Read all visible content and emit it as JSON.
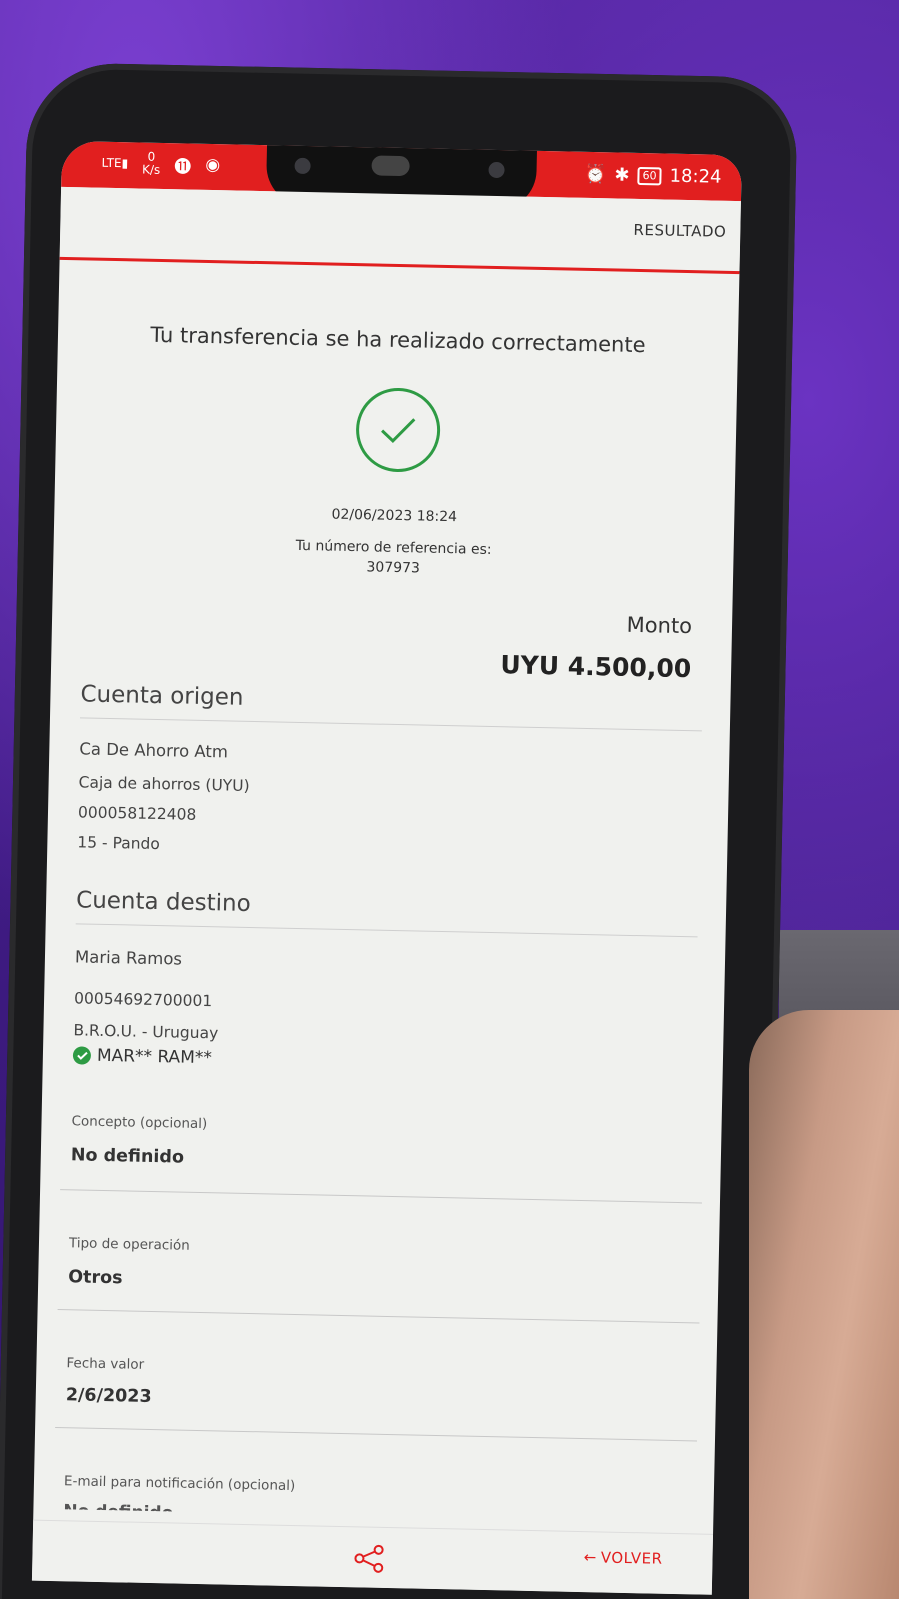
{
  "status_bar": {
    "network": "LTE",
    "speed_value": "0",
    "speed_unit": "K/s",
    "battery": "60",
    "time": "18:24"
  },
  "header": {
    "title": "RESULTADO"
  },
  "result": {
    "message": "Tu transferencia se ha realizado correctamente",
    "datetime": "02/06/2023 18:24",
    "reference_label": "Tu número de referencia es:",
    "reference_number": "307973"
  },
  "amount": {
    "label": "Monto",
    "value": "UYU 4.500,00"
  },
  "origin": {
    "title": "Cuenta origen",
    "name": "Ca De Ahorro Atm",
    "type": "Caja de ahorros (UYU)",
    "number": "000058122408",
    "branch": "15 - Pando"
  },
  "destination": {
    "title": "Cuenta destino",
    "name": "Maria Ramos",
    "number": "00054692700001",
    "bank": "B.R.O.U. - Uruguay",
    "verified_name": "MAR** RAM**"
  },
  "fields": {
    "concepto_label": "Concepto (opcional)",
    "concepto_value": "No definido",
    "tipo_label": "Tipo de operación",
    "tipo_value": "Otros",
    "fecha_label": "Fecha valor",
    "fecha_value": "2/6/2023",
    "email_label": "E-mail para notificación (opcional)",
    "email_value": "No definido"
  },
  "bottom": {
    "volver": "VOLVER"
  },
  "colors": {
    "accent": "#e11f1f",
    "success": "#2e9b44"
  }
}
